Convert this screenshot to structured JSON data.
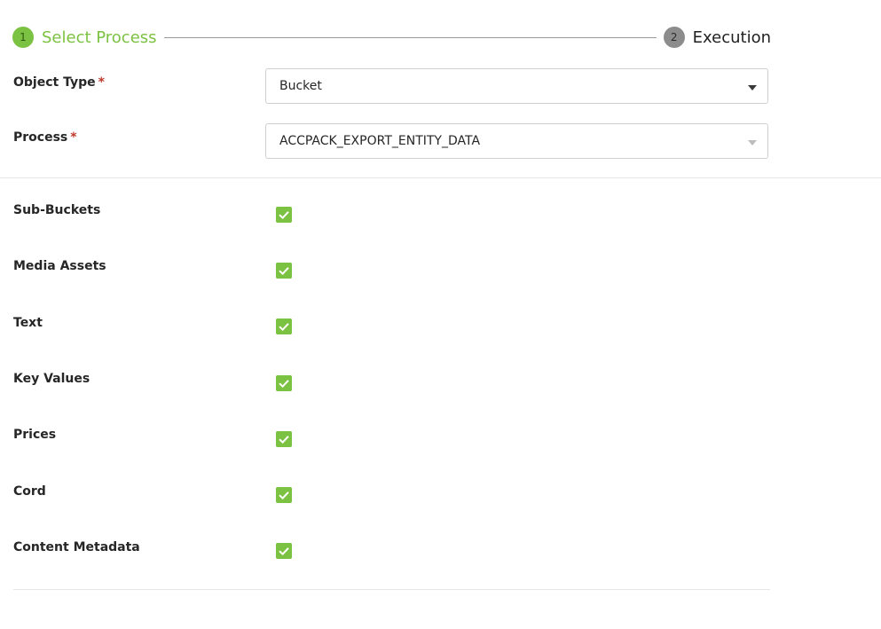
{
  "stepper": {
    "steps": [
      {
        "number": "1",
        "label": "Select Process",
        "state": "active"
      },
      {
        "number": "2",
        "label": "Execution",
        "state": "inactive"
      }
    ]
  },
  "form": {
    "object_type": {
      "label": "Object Type",
      "required_mark": "*",
      "value": "Bucket"
    },
    "process": {
      "label": "Process",
      "required_mark": "*",
      "value": "ACCPACK_EXPORT_ENTITY_DATA"
    }
  },
  "options": [
    {
      "label": "Sub-Buckets",
      "checked": true
    },
    {
      "label": "Media Assets",
      "checked": true
    },
    {
      "label": "Text",
      "checked": true
    },
    {
      "label": "Key Values",
      "checked": true
    },
    {
      "label": "Prices",
      "checked": true
    },
    {
      "label": "Cord",
      "checked": true
    },
    {
      "label": "Content Metadata",
      "checked": true
    }
  ],
  "colors": {
    "accent": "#7cc242",
    "inactive_step": "#8c8c8c",
    "required": "#c0392b"
  },
  "icons": {
    "dropdown": "chevron-down-icon",
    "check": "checkmark-icon"
  }
}
